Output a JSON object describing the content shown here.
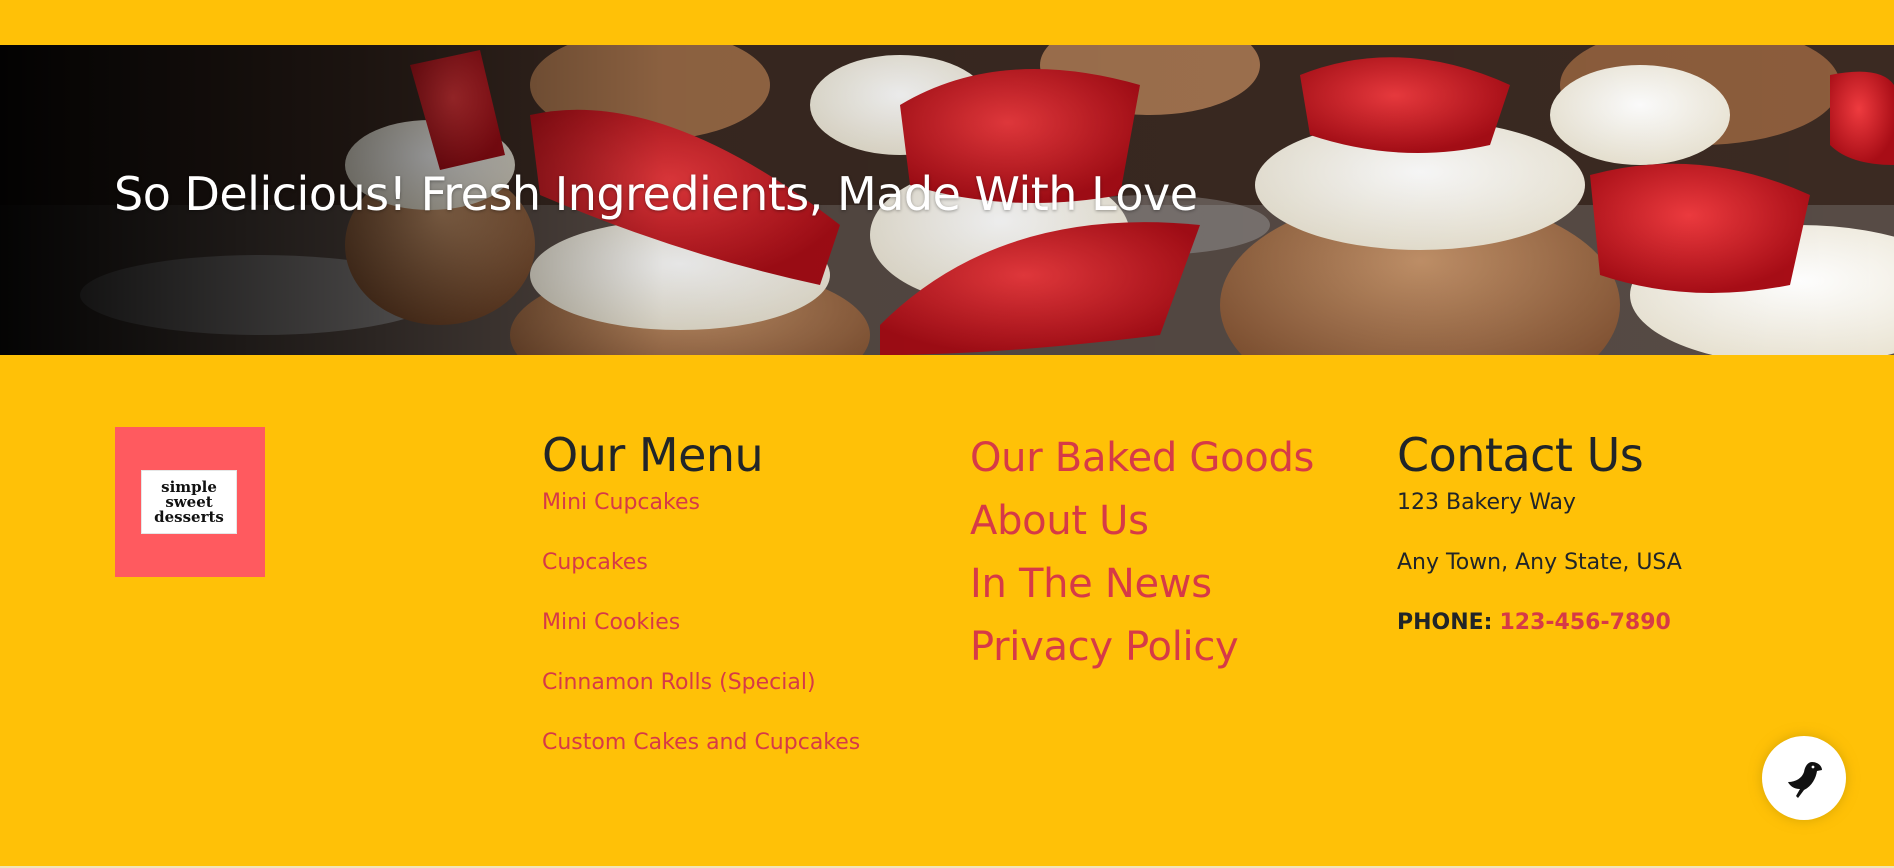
{
  "hero": {
    "title": "So Delicious! Fresh Ingredients, Made With Love"
  },
  "logo": {
    "line1": "simple",
    "line2": "sweet",
    "line3": "desserts"
  },
  "menu": {
    "heading": "Our Menu",
    "items": [
      "Mini Cupcakes",
      "Cupcakes",
      "Mini Cookies",
      "Cinnamon Rolls (Special)",
      "Custom Cakes and Cupcakes"
    ]
  },
  "links": {
    "items": [
      "Our Baked Goods",
      "About Us",
      "In The News",
      "Privacy Policy"
    ]
  },
  "contact": {
    "heading": "Contact Us",
    "address1": "123 Bakery Way",
    "address2": "Any Town, Any State, USA",
    "phone_label": "PHONE:",
    "phone_number": "123-456-7890"
  },
  "chat": {
    "icon": "bird-icon"
  },
  "colors": {
    "background": "#ffc107",
    "accent": "#d63a47",
    "logo_bg": "#ff5a5f",
    "text": "#212529"
  }
}
